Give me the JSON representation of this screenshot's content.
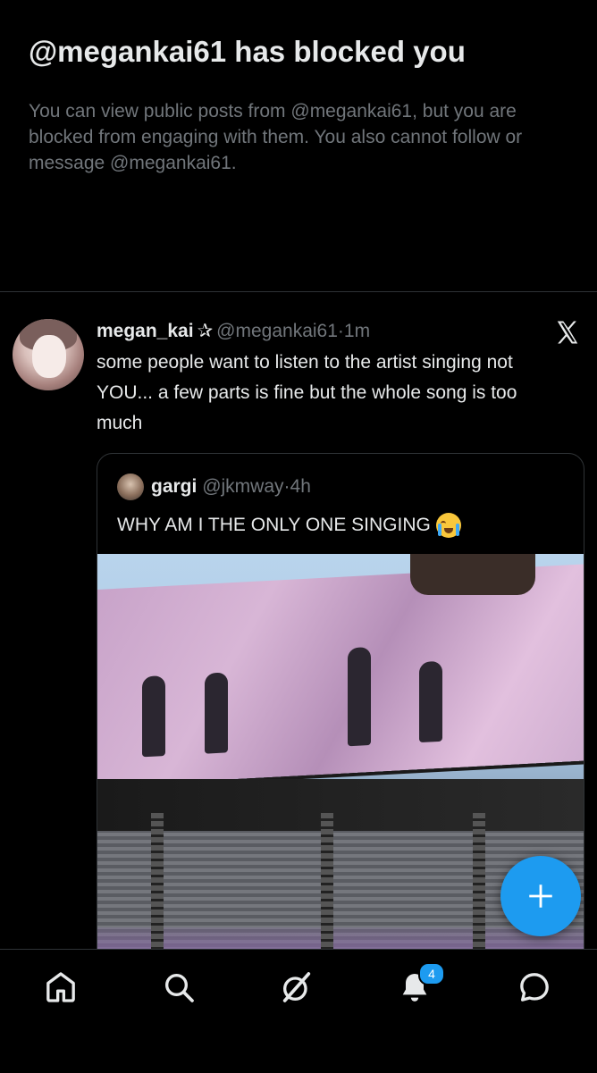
{
  "blocked": {
    "title": "@megankai61 has blocked you",
    "description": "You can view public posts from @megankai61, but you are blocked from engaging with them. You also cannot follow or message @megankai61."
  },
  "post": {
    "display_name": "megan_kai",
    "name_symbol": "✰",
    "handle": "@megankai61",
    "separator": "·",
    "time": "1m",
    "text": "some people want to listen to the artist singing not YOU... a few parts is fine but the whole song is too much",
    "source_icon": "x-logo-icon"
  },
  "quote": {
    "display_name": "gargi",
    "handle": "@jkmway",
    "separator": "·",
    "time": "4h",
    "text": "WHY AM I THE ONLY ONE SINGING"
  },
  "compose": {
    "icon": "plus-icon"
  },
  "nav": {
    "items": [
      {
        "name": "home",
        "icon": "home-icon"
      },
      {
        "name": "search",
        "icon": "search-icon"
      },
      {
        "name": "grok",
        "icon": "grok-icon"
      },
      {
        "name": "notifications",
        "icon": "bell-icon",
        "badge": "4"
      },
      {
        "name": "messages",
        "icon": "message-icon"
      }
    ]
  },
  "colors": {
    "background": "#000000",
    "primary_text": "#e7e9ea",
    "secondary_text": "#71767b",
    "accent": "#1d9bf0",
    "border": "#2f3336"
  }
}
